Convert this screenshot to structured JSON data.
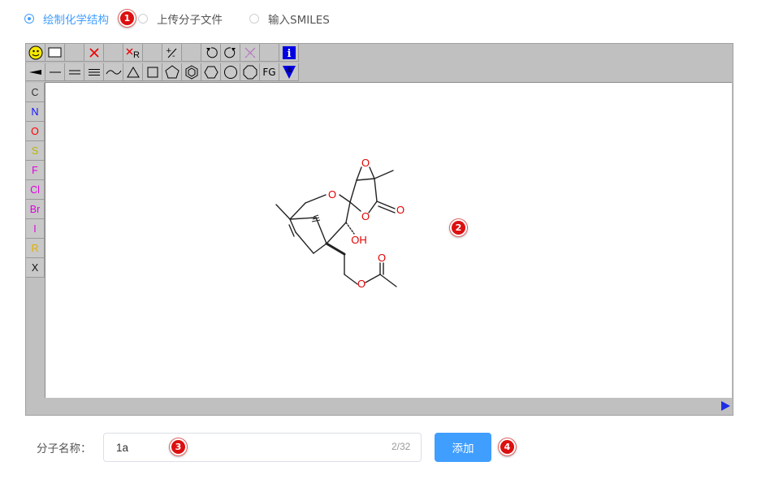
{
  "radios": [
    {
      "label": "绘制化学结构",
      "checked": true
    },
    {
      "label": "上传分子文件",
      "checked": false
    },
    {
      "label": "输入SMILES",
      "checked": false
    }
  ],
  "callouts": [
    "1",
    "2",
    "3",
    "4"
  ],
  "toolbar": {
    "row1": [
      "smiley-icon",
      "rect-select-icon",
      "",
      "delete-x-icon",
      "",
      "delete-r-icon",
      "",
      "charge-icon",
      "",
      "undo-icon",
      "redo-icon",
      "clear-icon",
      "",
      "info-icon"
    ],
    "row2": [
      "wedge-bond-icon",
      "single-bond-icon",
      "double-bond-icon",
      "triple-bond-icon",
      "chain-icon",
      "triangle-icon",
      "square-icon",
      "pentagon-icon",
      "benzene-icon",
      "hexagon-icon",
      "heptagon-icon",
      "octagon-icon",
      "FG",
      "template-icon"
    ]
  },
  "elements": [
    {
      "symbol": "C",
      "color": "#333333"
    },
    {
      "symbol": "N",
      "color": "#1010ff"
    },
    {
      "symbol": "O",
      "color": "#ff0000"
    },
    {
      "symbol": "S",
      "color": "#b8b800"
    },
    {
      "symbol": "F",
      "color": "#e000e0"
    },
    {
      "symbol": "Cl",
      "color": "#e000e0"
    },
    {
      "symbol": "Br",
      "color": "#e000e0"
    },
    {
      "symbol": "I",
      "color": "#e000e0"
    },
    {
      "symbol": "R",
      "color": "#e0b000"
    },
    {
      "symbol": "X",
      "color": "#111111"
    }
  ],
  "molecule": {
    "atom_labels": [
      "O",
      "O",
      "O",
      "O",
      "OH",
      "O",
      "O"
    ]
  },
  "form": {
    "label": "分子名称：",
    "value": "1a",
    "counter": "2/32",
    "add_label": "添加"
  }
}
